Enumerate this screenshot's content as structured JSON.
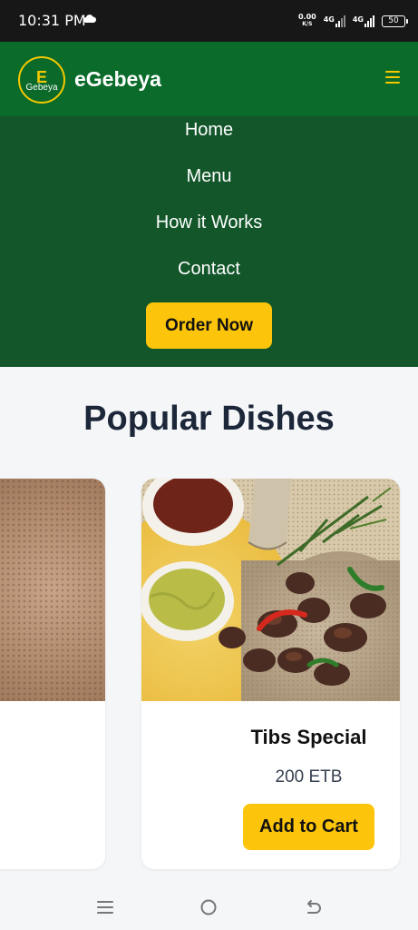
{
  "status_bar": {
    "time": "10:31 PM",
    "speed_value": "0.00",
    "speed_unit": "K/S",
    "net1": "4G",
    "net2": "4G",
    "battery": "50"
  },
  "header": {
    "logo_letter": "E",
    "logo_text": "Gebeya",
    "brand": "eGebeya",
    "menu_icon": "hamburger-icon",
    "accent_color": "#f5c800",
    "header_color": "#0a6b2a"
  },
  "nav": {
    "items": [
      {
        "label": "Home"
      },
      {
        "label": "Menu"
      },
      {
        "label": "How it Works"
      },
      {
        "label": "Contact"
      }
    ],
    "cta_label": "Order Now",
    "menu_color": "#12562a",
    "button_color": "#fcc40a"
  },
  "section": {
    "title": "Popular Dishes"
  },
  "dishes": [
    {
      "name": "",
      "price": "",
      "image": "injera"
    },
    {
      "name": "Tibs Special",
      "price": "200 ETB",
      "button": "Add to Cart",
      "image": "tibs-plate"
    }
  ],
  "system_nav": {
    "icons": [
      "recents-icon",
      "home-icon",
      "back-icon"
    ]
  }
}
